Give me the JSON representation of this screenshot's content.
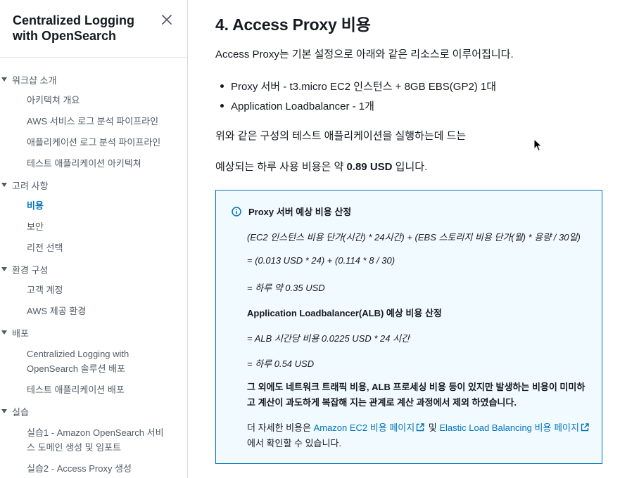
{
  "sidebar": {
    "title": "Centralized Logging with OpenSearch",
    "sections": [
      {
        "label": "워크샵 소개",
        "items": [
          "아키텍쳐 개요",
          "AWS 서비스 로그 분석 파이프라인",
          "애플리케이션 로그 분석 파이프라인",
          "테스트 애플리케이션 아키텍쳐"
        ]
      },
      {
        "label": "고려 사항",
        "items": [
          "비용",
          "보안",
          "리전 선택"
        ]
      },
      {
        "label": "환경 구성",
        "items": [
          "고객 계정",
          "AWS 제공 환경"
        ]
      },
      {
        "label": "배포",
        "items": [
          "Centralizied Logging with OpenSearch 솔루션 배포",
          "테스트 애플리케이션 배포"
        ]
      },
      {
        "label": "실습",
        "items": [
          "실습1 - Amazon OpenSearch 서비스 도메인 생성 및 임포트",
          "실습2 - Access Proxy 생성"
        ]
      }
    ],
    "active_item": "비용"
  },
  "main": {
    "heading": "4. Access Proxy 비용",
    "intro": "Access Proxy는 기본 설정으로 아래와 같은 리소스로 이루어집니다.",
    "bullets": [
      "Proxy 서버 - t3.micro EC2 인스턴스 + 8GB EBS(GP2) 1대",
      "Application Loadbalancer - 1개"
    ],
    "run_text": "위와 같은 구성의 테스트 애플리케이션을 실행하는데 드는",
    "cost_prefix": "예상되는 하루 사용 비용은 약 ",
    "cost_value": "0.89 USD",
    "cost_suffix": " 입니다.",
    "info": {
      "title": "Proxy 서버 예상 비용 산정",
      "formula1": "(EC2 인스턴스 비용 단가(시간) * 24시간) + (EBS 스토리지 비용 단가(월) * 용량 / 30일)",
      "formula2": "= (0.013 USD * 24) + (0.114 * 8 / 30)",
      "formula3": "= 하루 약 0.35 USD",
      "alb_title": "Application Loadbalancer(ALB) 예상 비용 산정",
      "alb_formula": "= ALB 시간당 비용 0.0225 USD * 24 시간",
      "alb_result": "= 하루 0.54 USD",
      "note": "그 외에도 네트워크 트래픽 비용, ALB 프로세싱 비용 등이 있지만 발생하는 비용이 미미하고 계산이 과도하게 복잡해 지는 관계로 계산 과정에서 제외 하였습니다.",
      "more_prefix": "더 자세한 비용은 ",
      "link1": "Amazon EC2 비용 페이지",
      "and_text": " 및 ",
      "link2": "Elastic Load Balancing 비용 페이지",
      "more_suffix": "에서 확인할 수 있습니다."
    }
  },
  "colors": {
    "link": "#0073bb",
    "info_bg": "#f1faff",
    "info_border": "#0073bb"
  }
}
